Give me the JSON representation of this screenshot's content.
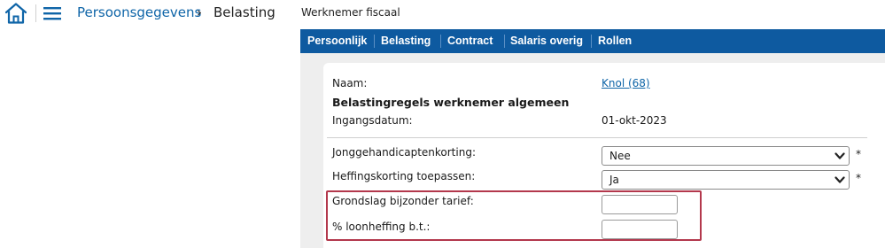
{
  "breadcrumb": {
    "root": "Persoonsgegevens",
    "separator": "›",
    "current": "Belasting"
  },
  "window_title": "Werknemer fiscaal",
  "tabs": [
    "Persoonlijk",
    "Belasting",
    "Contract",
    "Salaris overig",
    "Rollen"
  ],
  "form": {
    "naam_label": "Naam:",
    "naam_value": "Knol (68)",
    "section_heading": "Belastingregels werknemer algemeen",
    "ingangsdatum_label": "Ingangsdatum:",
    "ingangsdatum_value": "01-okt-2023",
    "jonggehandicapt_label": "Jonggehandicaptenkorting:",
    "jonggehandicapt_value": "Nee",
    "heffingskorting_label": "Heffingskorting toepassen:",
    "heffingskorting_value": "Ja",
    "required_mark": "*",
    "grondslag_label": "Grondslag bijzonder tarief:",
    "grondslag_value": "",
    "loonheffing_label": "% loonheffing b.t.:",
    "loonheffing_value": ""
  },
  "colors": {
    "primary_blue": "#0e5aa0",
    "link_blue": "#0f65a8",
    "highlight_red": "#b3384c",
    "content_gray": "#eeeeee"
  },
  "icons": {
    "home": "home-icon",
    "menu": "hamburger-menu-icon",
    "dropdown": "chevron-down-icon"
  }
}
